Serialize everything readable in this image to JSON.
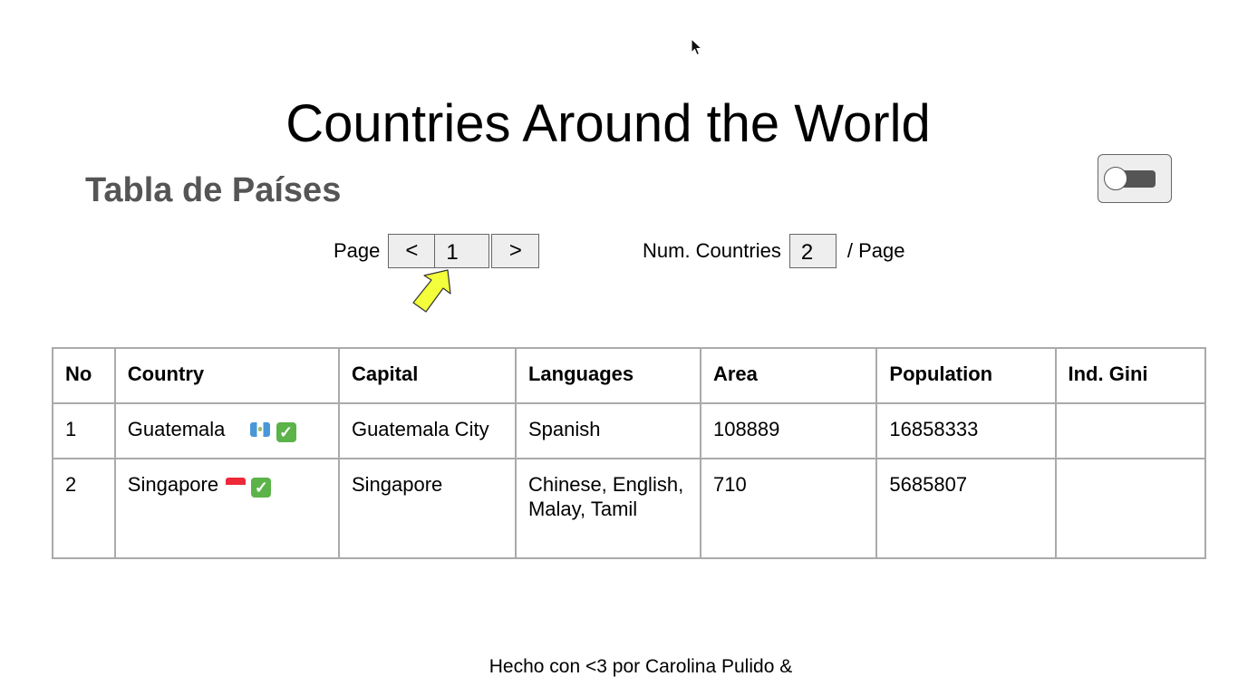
{
  "header": {
    "title": "Countries Around the World",
    "subtitle": "Tabla de Países"
  },
  "theme_toggle": {
    "state": "off"
  },
  "pagination": {
    "label": "Page",
    "prev_label": "<",
    "page_value": "1",
    "next_label": ">"
  },
  "per_page": {
    "label": "Num. Countries",
    "value": "2",
    "suffix": "/ Page"
  },
  "table": {
    "columns": [
      "No",
      "Country",
      "Capital",
      "Languages",
      "Area",
      "Population",
      "Ind. Gini"
    ],
    "rows": [
      {
        "no": "1",
        "country": "Guatemala",
        "flag_icon": "guatemala-flag-icon",
        "check": "✓",
        "capital": "Guatemala City",
        "languages": "Spanish",
        "area": "108889",
        "population": "16858333",
        "gini": ""
      },
      {
        "no": "2",
        "country": "Singapore",
        "flag_icon": "singapore-flag-icon",
        "check": "✓",
        "capital": "Singapore",
        "languages": "Chinese, English, Malay, Tamil",
        "area": "710",
        "population": "5685807",
        "gini": ""
      }
    ]
  },
  "footer": {
    "text": "Hecho con <3 por Carolina Pulido &"
  },
  "colors": {
    "subtitle": "#555555",
    "control_bg": "#eeeeee",
    "table_border": "#aaaaaa",
    "arrow_fill": "#f2ff3a",
    "check_green": "#5bb349"
  }
}
